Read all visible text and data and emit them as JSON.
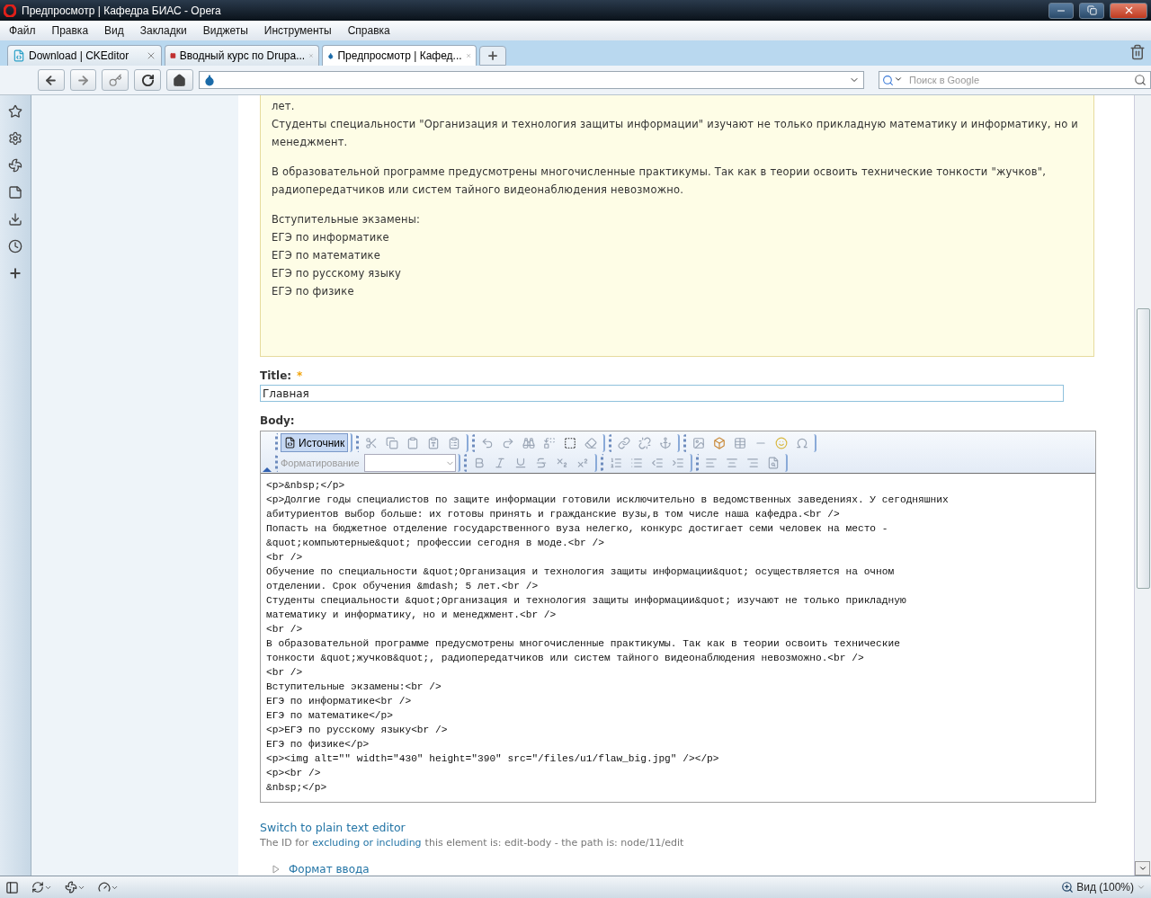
{
  "window": {
    "title": "Предпросмотр | Кафедра БИАС - Opera"
  },
  "menu": [
    "Файл",
    "Правка",
    "Вид",
    "Закладки",
    "Виджеты",
    "Инструменты",
    "Справка"
  ],
  "tabs": [
    {
      "label": "Download | CKEditor",
      "kind": "ckeditor",
      "selected": false
    },
    {
      "label": "Вводный курс по Drupa...",
      "kind": "cms",
      "selected": false
    },
    {
      "label": "Предпросмотр | Кафед...",
      "kind": "drupal",
      "selected": true
    }
  ],
  "search": {
    "placeholder": "Поиск в Google"
  },
  "preview": {
    "blocks": [
      [
        "лет.",
        "Студенты специальности \"Организация и технология защиты информации\" изучают не только прикладную математику и информатику, но и менеджмент."
      ],
      [
        "В образовательной программе предусмотрены многочисленные практикумы. Так как в теории освоить технические тонкости \"жучков\", радиопередатчиков или систем тайного видеонаблюдения невозможно."
      ],
      [
        "Вступительные экзамены:",
        "ЕГЭ по информатике",
        "ЕГЭ по математике",
        "ЕГЭ по русскому языку",
        "ЕГЭ по физике"
      ]
    ]
  },
  "title_field": {
    "label": "Title:",
    "required_mark": "*",
    "value": "Главная"
  },
  "body": {
    "label": "Body:",
    "source_button": {
      "label": "Источник",
      "selected": true
    },
    "format_label": "Форматирование",
    "code_lines": [
      "<p>&nbsp;</p>",
      "<p>Долгие годы специалистов по защите информации готовили исключительно в ведомственных заведениях. У сегодняшних",
      "абитуриентов выбор больше: их готовы принять и гражданские вузы,в том числе наша кафедра.<br />",
      "Попасть на бюджетное отделение государственного вуза нелегко, конкурс достигает семи человек на место -",
      "&quot;компьютерные&quot; профессии сегодня в моде.<br />",
      "<br />",
      "Обучение по специальности &quot;Организация и технология защиты информации&quot; осуществляется на очном",
      "отделении. Срок обучения &mdash; 5 лет.<br />",
      "Студенты специальности &quot;Организация и технология защиты информации&quot; изучают не только прикладную",
      "математику и информатику, но и менеджмент.<br />",
      "<br />",
      "В образовательной программе предусмотрены многочисленные практикумы. Так как в теории освоить технические",
      "тонкости &quot;жучков&quot;, радиопередатчиков или систем тайного видеонаблюдения невозможно.<br />",
      "<br />",
      "Вступительные экзамены:<br />",
      "ЕГЭ по информатике<br />",
      "ЕГЭ по математике</p>",
      "<p>ЕГЭ по русскому языку<br />",
      "ЕГЭ по физике</p>",
      "<p><img alt=\"\" width=\"430\" height=\"390\" src=\"/files/u1/flaw_big.jpg\" /></p>",
      "<p><br />",
      "&nbsp;</p>"
    ]
  },
  "switch_link": "Switch to plain text editor",
  "id_note": {
    "before": "The ID for",
    "link": "excluding or including",
    "after": "this element is: edit-body - the path is: node/11/edit"
  },
  "input_format": "Формат ввода",
  "status_bar": {
    "zoom": "Вид (100%)"
  }
}
